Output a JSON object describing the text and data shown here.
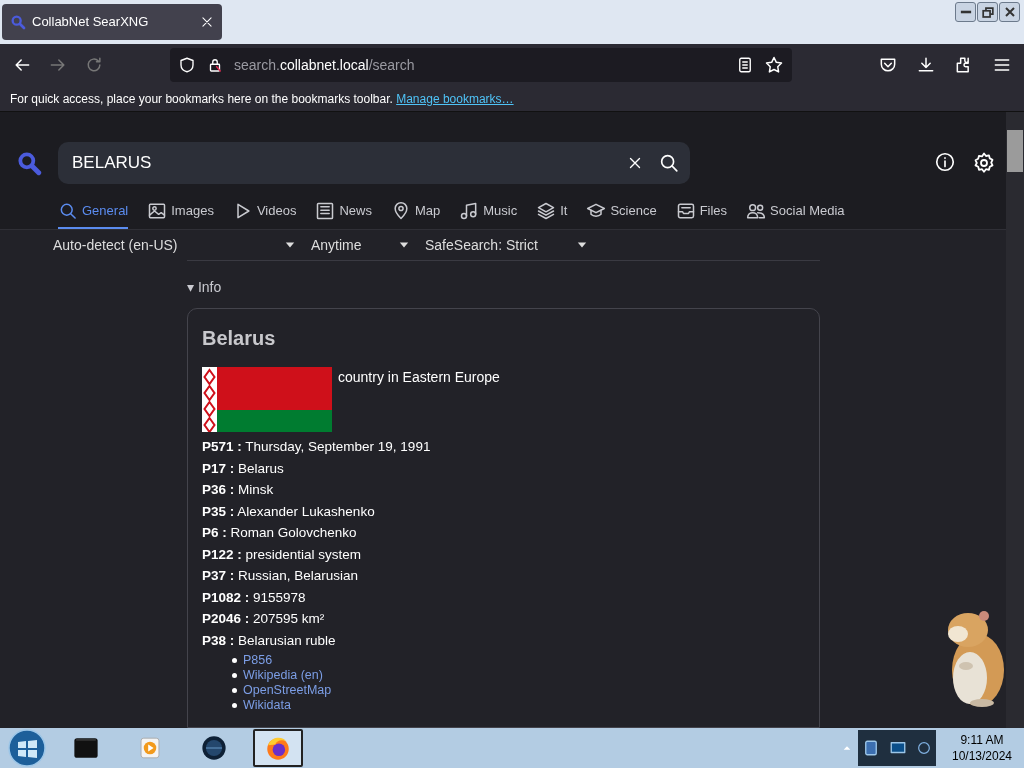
{
  "browser": {
    "tab": {
      "title": "CollabNet SearXNG",
      "selected": true
    },
    "url": {
      "prefix": "search.",
      "domain": "collabnet.local",
      "path": "/search"
    },
    "bookmarks_bar": {
      "message": "For quick access, place your bookmarks here on the bookmarks toolbar.",
      "link": "Manage bookmarks…"
    }
  },
  "search": {
    "query": "BELARUS"
  },
  "categories": [
    {
      "label": "General",
      "selected": true
    },
    {
      "label": "Images",
      "selected": false
    },
    {
      "label": "Videos",
      "selected": false
    },
    {
      "label": "News",
      "selected": false
    },
    {
      "label": "Map",
      "selected": false
    },
    {
      "label": "Music",
      "selected": false
    },
    {
      "label": "It",
      "selected": false
    },
    {
      "label": "Science",
      "selected": false
    },
    {
      "label": "Files",
      "selected": false
    },
    {
      "label": "Social Media",
      "selected": false
    }
  ],
  "filters": [
    {
      "value": "Auto-detect (en-US)"
    },
    {
      "value": "Anytime"
    },
    {
      "value": "SafeSearch: Strict"
    }
  ],
  "info": {
    "toggle": "▾ Info",
    "title": "Belarus",
    "description": "country in Eastern Europe",
    "attributes": [
      {
        "key": "P571 :",
        "value": "Thursday, September 19, 1991"
      },
      {
        "key": "P17 :",
        "value": "Belarus"
      },
      {
        "key": "P36 :",
        "value": "Minsk"
      },
      {
        "key": "P35 :",
        "value": "Alexander Lukashenko"
      },
      {
        "key": "P6 :",
        "value": "Roman Golovchenko"
      },
      {
        "key": "P122 :",
        "value": "presidential system"
      },
      {
        "key": "P37 :",
        "value": "Russian, Belarusian"
      },
      {
        "key": "P1082 :",
        "value": "9155978"
      },
      {
        "key": "P2046 :",
        "value": "207595 km²"
      },
      {
        "key": "P38 :",
        "value": "Belarusian ruble"
      }
    ],
    "links": [
      "P856",
      "Wikipedia (en)",
      "OpenStreetMap",
      "Wikidata"
    ]
  },
  "taskbar": {
    "apps": [
      {
        "kind": "box",
        "selected": false
      },
      {
        "kind": "player",
        "selected": false
      },
      {
        "kind": "globe",
        "selected": false
      },
      {
        "kind": "firefox",
        "selected": true
      }
    ],
    "time": "9:11 AM",
    "date": "10/13/2024"
  }
}
